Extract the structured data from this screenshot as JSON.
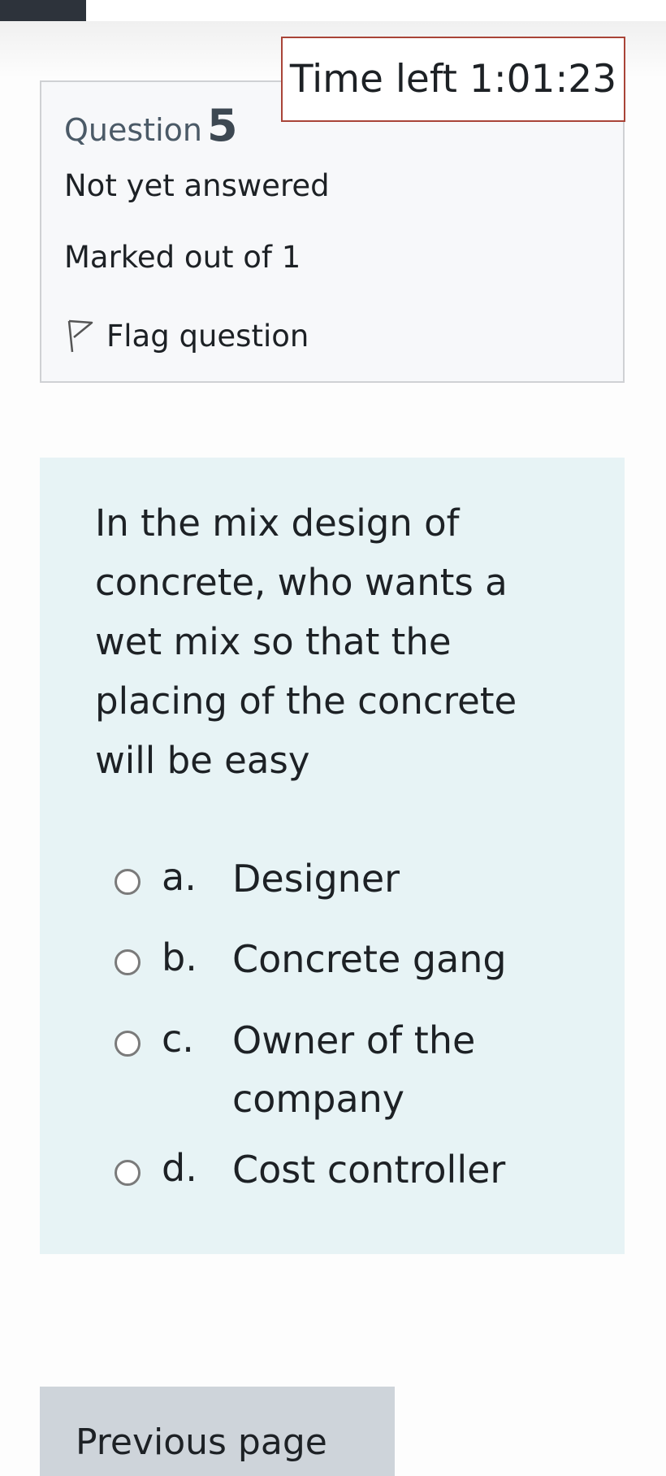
{
  "timer": {
    "label": "Time left 1:01:23"
  },
  "question_info": {
    "question_word": "Question",
    "question_number": "5",
    "status": "Not yet answered",
    "marks": "Marked out of 1",
    "flag_label": "Flag question"
  },
  "question": {
    "text": "In the mix design of concrete, who wants a wet mix so that the placing of the concrete will be easy",
    "options": [
      {
        "letter": "a.",
        "text": "Designer"
      },
      {
        "letter": "b.",
        "text": "Concrete gang"
      },
      {
        "letter": "c.",
        "text": "Owner of the company"
      },
      {
        "letter": "d.",
        "text": "Cost controller"
      }
    ]
  },
  "navigation": {
    "previous_label": "Previous page"
  },
  "colors": {
    "timer_border": "#a94438",
    "question_background": "#e7f3f5",
    "info_background": "#f7f8fa",
    "button_background": "#ced4da"
  }
}
